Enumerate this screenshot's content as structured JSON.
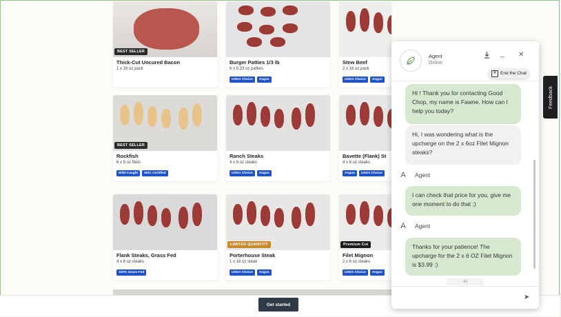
{
  "products": [
    {
      "title": "Thick-Cut Uncured Bacon",
      "sub": "1 x 16 oz pack",
      "badge": "BEST SELLER",
      "tags": []
    },
    {
      "title": "Burger Patties 1/3 lb",
      "sub": "6 x 5.33 oz patties",
      "badge": "",
      "tags": [
        "USDA Choice",
        "Angus"
      ]
    },
    {
      "title": "Stew Beef",
      "sub": "2 x 16 oz pack",
      "badge": "",
      "tags": [
        "USDA Choice",
        "Angus"
      ]
    },
    {
      "title": "Rockfish",
      "sub": "6 x 5 oz filets",
      "badge": "BEST SELLER",
      "tags": [
        "Wild-Caught",
        "MSC Certified"
      ]
    },
    {
      "title": "Ranch Steaks",
      "sub": "4 x 6 oz steaks",
      "badge": "",
      "tags": [
        "USDA Choice",
        "Angus"
      ]
    },
    {
      "title": "Bavette (Flank) St",
      "sub": "4 x 6 oz steaks",
      "badge": "",
      "tags": [
        "Angus",
        "USDA Choice"
      ]
    },
    {
      "title": "Flank Steaks, Grass Fed",
      "sub": "4 x 6 oz steaks",
      "badge": "",
      "tags": [
        "100% Grass-Fed"
      ]
    },
    {
      "title": "Porterhouse Steak",
      "sub": "1 x 16 oz steak",
      "badge": "LIMITED QUANTITY",
      "tags": [
        "USDA Choice",
        "Angus"
      ]
    },
    {
      "title": "Filet Mignon",
      "sub": "2 x 6 oz steaks",
      "badge": "Premium Cut",
      "tags": [
        "USDA Choice",
        "Angus"
      ]
    }
  ],
  "get_started": "Get started",
  "feedback": "Feedback",
  "chat": {
    "agent_name": "Agent",
    "status": "Online",
    "end_chat": "End the Chat",
    "messages": [
      {
        "from": "agent",
        "text": "Hi          ! Thank you for contacting Good Chop, my name is Fawne. How can I help you today?"
      },
      {
        "from": "user",
        "text": "Hi, I was wondering what is the upcharge on the 2 x 6oz Filet Mignon steaks?"
      },
      {
        "from": "agent",
        "text": "I can check that price for you, give me one moment to do that :)"
      },
      {
        "from": "agent",
        "text": "Thanks for your patience! The upcharge for the 2 x 6 OZ Filet Mignon is $3.99 :)"
      }
    ],
    "sender_label": "Agent",
    "sender_initial": "A",
    "timestamp": "›41"
  },
  "colors": {
    "tag": "#1e54c8",
    "chat_agent_bg": "#d6e8cf",
    "button": "#2f3a47"
  }
}
